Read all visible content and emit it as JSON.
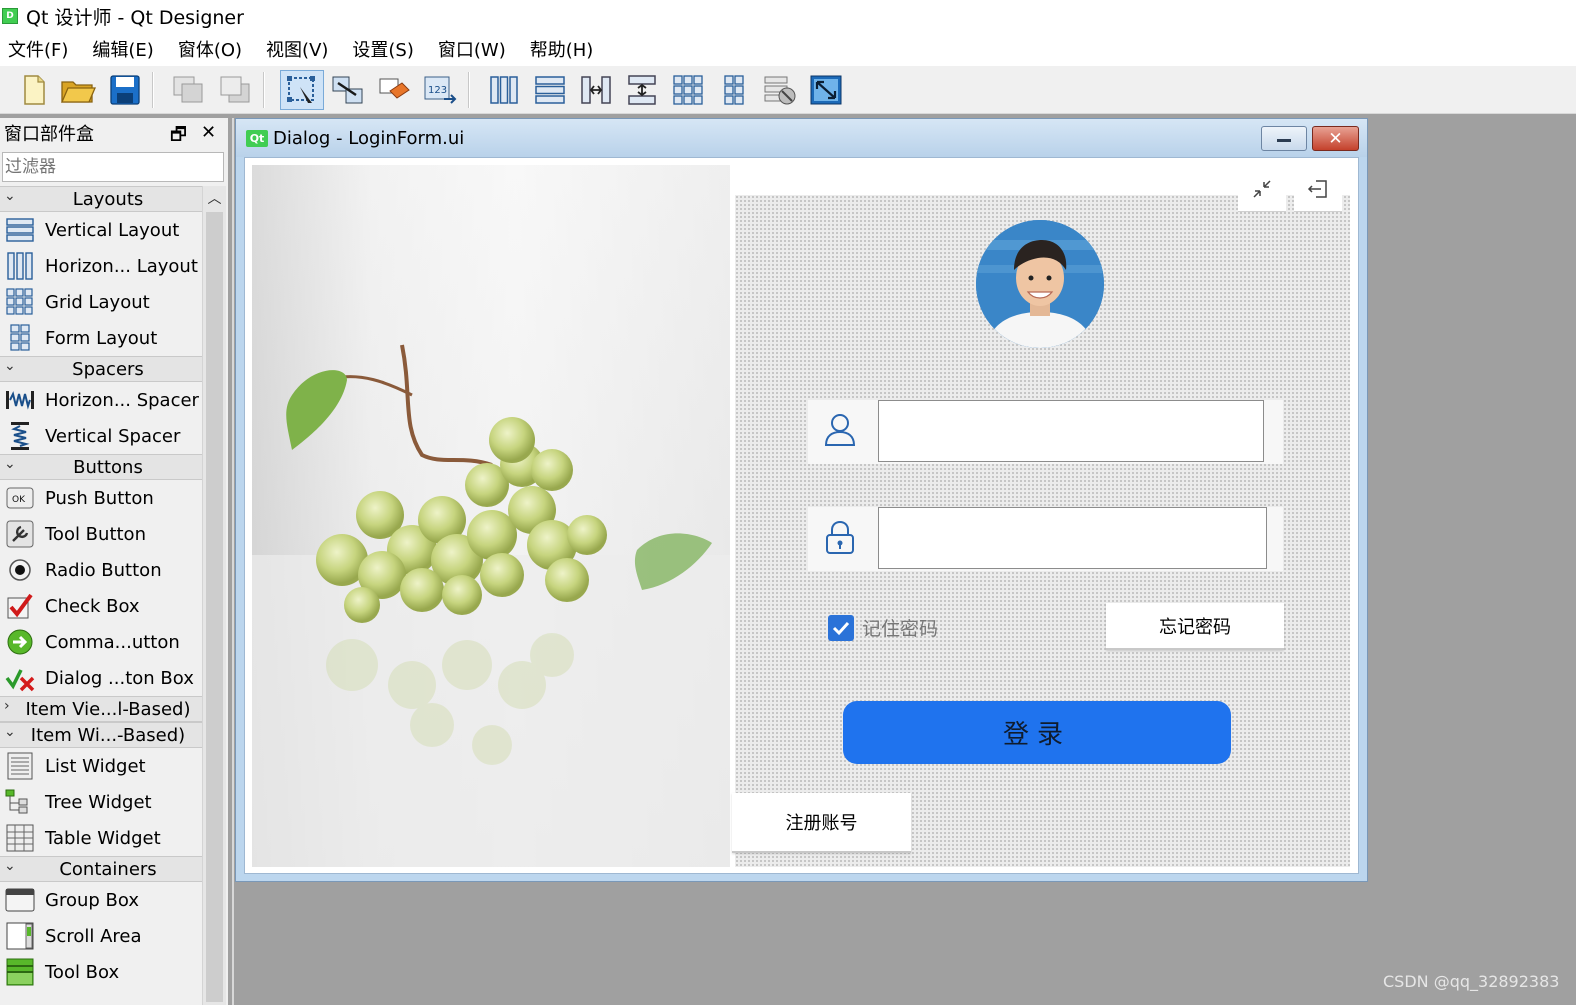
{
  "window": {
    "title": "Qt 设计师 - Qt Designer",
    "app_icon_letter": "D"
  },
  "menu": [
    "文件(F)",
    "编辑(E)",
    "窗体(O)",
    "视图(V)",
    "设置(S)",
    "窗口(W)",
    "帮助(H)"
  ],
  "toolbar": {
    "buttons": [
      "new-file",
      "open-file",
      "save-file",
      "send-to-back",
      "bring-to-front",
      "edit-widgets",
      "edit-signals-slots",
      "edit-buddies",
      "edit-tab-order",
      "lay-out-horizontally",
      "lay-out-vertically",
      "lay-out-horizontally-in-splitter",
      "lay-out-vertically-in-splitter",
      "lay-out-in-grid",
      "lay-out-in-form",
      "break-layout",
      "adjust-size"
    ],
    "active": "edit-widgets"
  },
  "widget_box": {
    "title": "窗口部件盒",
    "filter_placeholder": "过滤器",
    "categories": [
      {
        "label": "Layouts",
        "expanded": true,
        "items": [
          {
            "label": "Vertical Layout",
            "icon": "vertical-layout-icon"
          },
          {
            "label": "Horizon... Layout",
            "icon": "horizontal-layout-icon"
          },
          {
            "label": "Grid Layout",
            "icon": "grid-layout-icon"
          },
          {
            "label": "Form Layout",
            "icon": "form-layout-icon"
          }
        ]
      },
      {
        "label": "Spacers",
        "expanded": true,
        "items": [
          {
            "label": "Horizon... Spacer",
            "icon": "horizontal-spacer-icon"
          },
          {
            "label": "Vertical Spacer",
            "icon": "vertical-spacer-icon"
          }
        ]
      },
      {
        "label": "Buttons",
        "expanded": true,
        "items": [
          {
            "label": "Push Button",
            "icon": "push-button-icon"
          },
          {
            "label": "Tool Button",
            "icon": "tool-button-icon"
          },
          {
            "label": "Radio Button",
            "icon": "radio-button-icon"
          },
          {
            "label": "Check Box",
            "icon": "check-box-icon"
          },
          {
            "label": "Comma...utton",
            "icon": "command-link-icon"
          },
          {
            "label": "Dialog ...ton Box",
            "icon": "dialog-button-box-icon"
          }
        ]
      },
      {
        "label": "Item Vie...l-Based)",
        "expanded": false,
        "items": []
      },
      {
        "label": "Item Wi...-Based)",
        "expanded": true,
        "items": [
          {
            "label": "List Widget",
            "icon": "list-widget-icon"
          },
          {
            "label": "Tree Widget",
            "icon": "tree-widget-icon"
          },
          {
            "label": "Table Widget",
            "icon": "table-widget-icon"
          }
        ]
      },
      {
        "label": "Containers",
        "expanded": true,
        "items": [
          {
            "label": "Group Box",
            "icon": "group-box-icon"
          },
          {
            "label": "Scroll Area",
            "icon": "scroll-area-icon"
          },
          {
            "label": "Tool Box",
            "icon": "tool-box-icon"
          }
        ]
      }
    ]
  },
  "dialog": {
    "title": "Dialog - LoginForm.ui",
    "badge": "Qt",
    "form": {
      "username_value": "",
      "password_value": "",
      "remember_label": "记住密码",
      "remember_checked": true,
      "forgot_label": "忘记密码",
      "login_label": "登录",
      "register_label": "注册账号"
    }
  },
  "watermark": "CSDN @qq_32892383",
  "colors": {
    "accent": "#1f73ee",
    "checkbox": "#2a72d8",
    "dialog_frame": "#bcd6ee",
    "mdi_background": "#a0a0a0"
  }
}
